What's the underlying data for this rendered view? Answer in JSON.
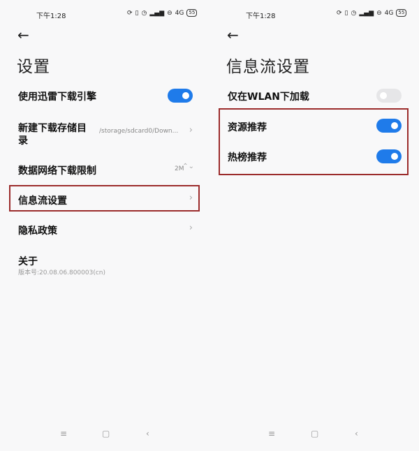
{
  "status": {
    "time": "下午1:28",
    "network_label": "4G",
    "battery": "55"
  },
  "left": {
    "title": "设置",
    "items": [
      {
        "label": "使用迅雷下载引擎",
        "toggle": true
      },
      {
        "label": "新建下载存储目",
        "label2": "录",
        "value": "/storage/sdcard0/Down..."
      },
      {
        "label": "数据网络下载限制",
        "value": "2M"
      },
      {
        "label": "信息流设置"
      },
      {
        "label": "隐私政策"
      },
      {
        "label": "关于",
        "sub": "版本号:20.08.06.800003(cn)"
      }
    ]
  },
  "right": {
    "title": "信息流设置",
    "items": [
      {
        "label": "仅在WLAN下加载",
        "toggle": false
      },
      {
        "label": "资源推荐",
        "toggle": true
      },
      {
        "label": "热榜推荐",
        "toggle": true
      }
    ]
  },
  "icons": {
    "back": "←",
    "chevron_right": "›",
    "updown": "⌃⌄",
    "menu": "≡",
    "home": "▢",
    "back_nav": "‹"
  },
  "colors": {
    "toggle_on": "#1f7bea",
    "toggle_off": "#e6e6e8",
    "highlight": "#9b2b2b"
  }
}
